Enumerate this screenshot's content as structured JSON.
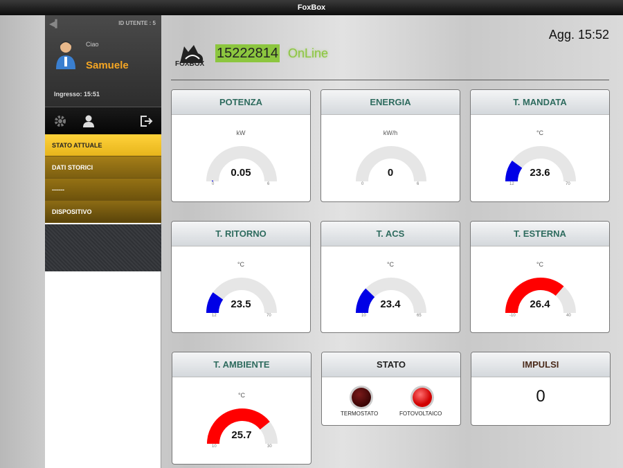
{
  "window": {
    "title": "FoxBox"
  },
  "sidebar": {
    "user_id_label": "ID UTENTE : 5",
    "greeting": "Ciao",
    "username": "Samuele",
    "login_label": "Ingresso: 15:51",
    "tools": [
      {
        "icon": "gear-icon"
      },
      {
        "icon": "user-icon"
      },
      {
        "icon": "logout-icon"
      }
    ],
    "menu": [
      {
        "label": "STATO ATTUALE",
        "active": true
      },
      {
        "label": "DATI STORICI",
        "active": false
      },
      {
        "label": "------",
        "active": false
      },
      {
        "label": "DISPOSITIVO",
        "active": false
      }
    ]
  },
  "header": {
    "logo_text": "FOXBOX",
    "device_id": "15222814",
    "status": "OnLine",
    "updated": "Agg. 15:52"
  },
  "colors": {
    "accent_green": "#8cc63f",
    "menu_gold": "#ffd23a",
    "gauge_blue": "#0000e6",
    "gauge_red": "#ff0000",
    "gauge_track": "#e6e6e6"
  },
  "gauges": [
    {
      "title": "POTENZA",
      "unit": "kW",
      "value": "0.05",
      "min": "0",
      "max": "6",
      "num": 0.05,
      "lo": 0,
      "hi": 6,
      "color": "#0000e6"
    },
    {
      "title": "ENERGIA",
      "unit": "kW/h",
      "value": "0",
      "min": "0",
      "max": "6",
      "num": 0,
      "lo": 0,
      "hi": 6,
      "color": "#0000e6"
    },
    {
      "title": "T. MANDATA",
      "unit": "°C",
      "value": "23.6",
      "min": "12",
      "max": "70",
      "num": 23.6,
      "lo": 12,
      "hi": 70,
      "color": "#0000e6"
    },
    {
      "title": "T. RITORNO",
      "unit": "°C",
      "value": "23.5",
      "min": "12",
      "max": "70",
      "num": 23.5,
      "lo": 12,
      "hi": 70,
      "color": "#0000e6"
    },
    {
      "title": "T. ACS",
      "unit": "°C",
      "value": "23.4",
      "min": "10",
      "max": "65",
      "num": 23.4,
      "lo": 10,
      "hi": 65,
      "color": "#0000e6"
    },
    {
      "title": "T. ESTERNA",
      "unit": "°C",
      "value": "26.4",
      "min": "-10",
      "max": "40",
      "num": 26.4,
      "lo": -10,
      "hi": 40,
      "color": "#ff0000"
    },
    {
      "title": "T. AMBIENTE",
      "unit": "°C",
      "value": "25.7",
      "min": "10",
      "max": "30",
      "num": 25.7,
      "lo": 10,
      "hi": 30,
      "color": "#ff0000"
    }
  ],
  "stato": {
    "title": "STATO",
    "leds": [
      {
        "label": "TERMOSTATO",
        "on": false
      },
      {
        "label": "FOTOVOLTAICO",
        "on": true
      }
    ]
  },
  "impulsi": {
    "title": "IMPULSI",
    "value": "0"
  }
}
